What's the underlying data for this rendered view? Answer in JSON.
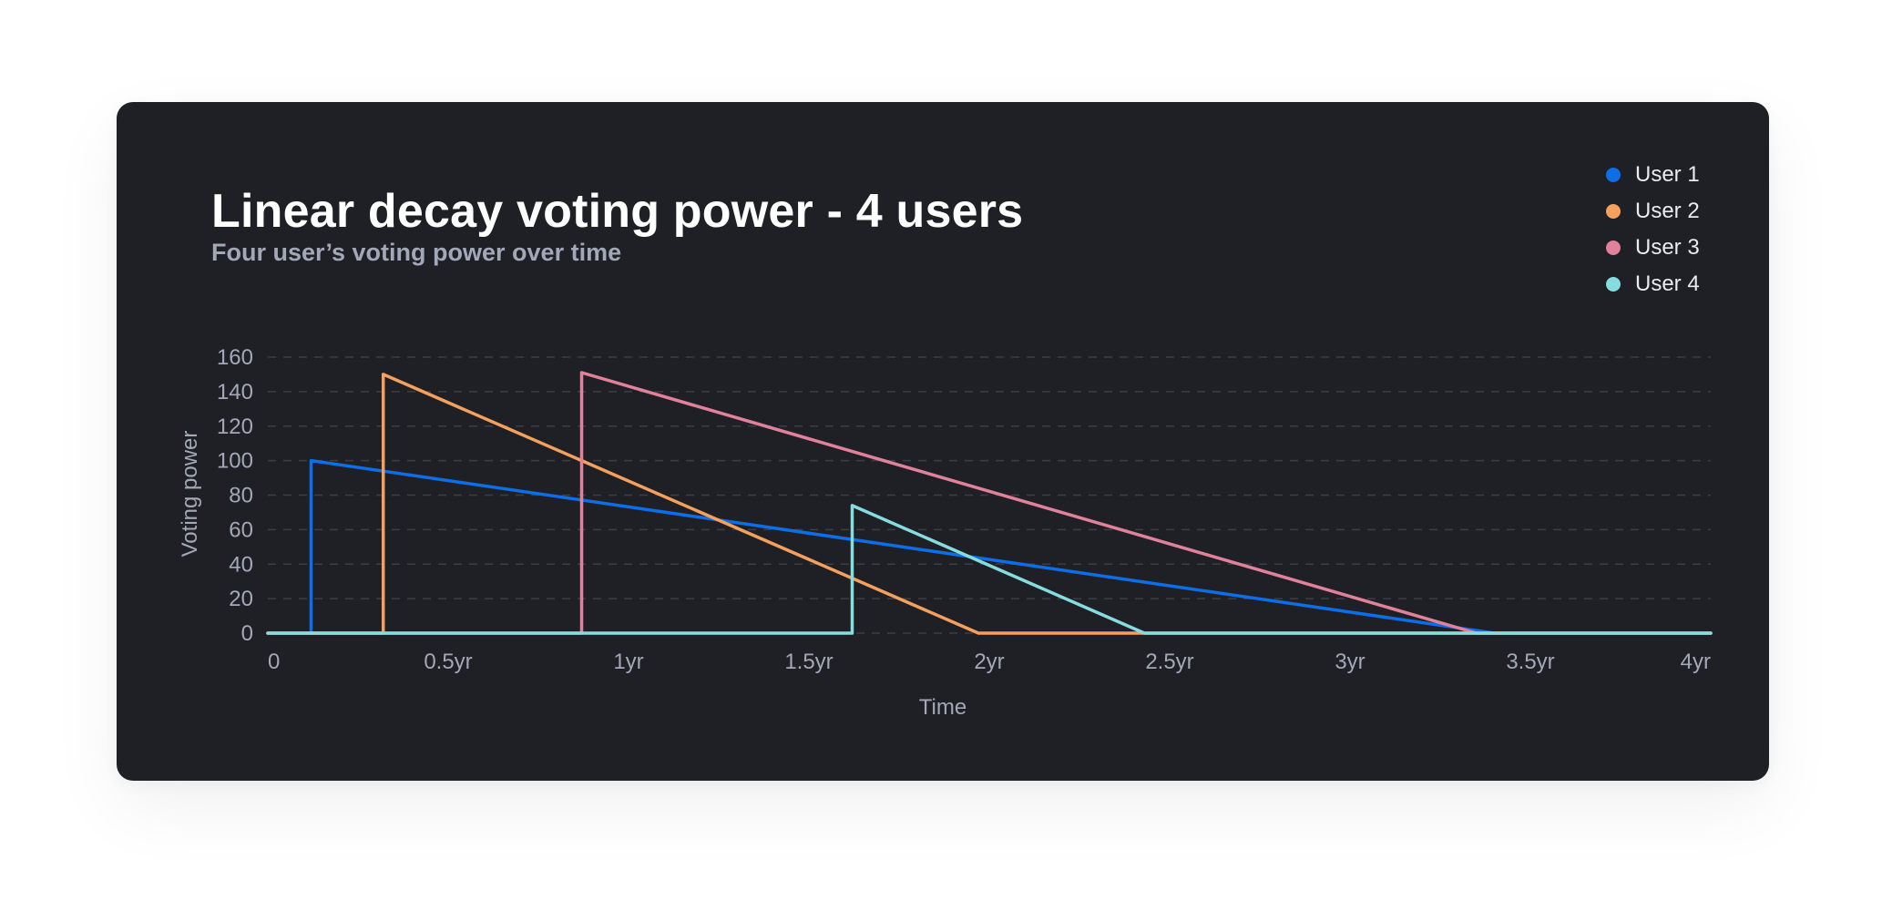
{
  "chart_data": {
    "type": "line",
    "title": "Linear decay voting power - 4 users",
    "subtitle": "Four user’s voting power over time",
    "xlabel": "Time",
    "ylabel": "Voting power",
    "xlim": [
      0,
      4
    ],
    "ylim": [
      0,
      160
    ],
    "x_ticks": [
      {
        "value": 0,
        "label": "0"
      },
      {
        "value": 0.5,
        "label": "0.5yr"
      },
      {
        "value": 1,
        "label": "1yr"
      },
      {
        "value": 1.5,
        "label": "1.5yr"
      },
      {
        "value": 2,
        "label": "2yr"
      },
      {
        "value": 2.5,
        "label": "2.5yr"
      },
      {
        "value": 3,
        "label": "3yr"
      },
      {
        "value": 3.5,
        "label": "3.5yr"
      },
      {
        "value": 4,
        "label": "4yr"
      }
    ],
    "y_ticks": [
      0,
      20,
      40,
      60,
      80,
      100,
      120,
      140,
      160
    ],
    "grid": true,
    "legend_position": "top-right",
    "series": [
      {
        "name": "User 1",
        "color": "#0d6ee8",
        "points": [
          [
            0,
            0
          ],
          [
            0.12,
            0
          ],
          [
            0.12,
            100
          ],
          [
            3.4,
            0
          ],
          [
            4,
            0
          ]
        ]
      },
      {
        "name": "User 2",
        "color": "#f5a05c",
        "points": [
          [
            0,
            0
          ],
          [
            0.32,
            0
          ],
          [
            0.32,
            150
          ],
          [
            1.97,
            0
          ],
          [
            4,
            0
          ]
        ]
      },
      {
        "name": "User 3",
        "color": "#e1819a",
        "points": [
          [
            0,
            0
          ],
          [
            0.87,
            0
          ],
          [
            0.87,
            151
          ],
          [
            3.35,
            0
          ],
          [
            4,
            0
          ]
        ]
      },
      {
        "name": "User 4",
        "color": "#86dde0",
        "points": [
          [
            0,
            0
          ],
          [
            1.62,
            0
          ],
          [
            1.62,
            74
          ],
          [
            2.43,
            0
          ],
          [
            4,
            0
          ]
        ]
      }
    ]
  }
}
